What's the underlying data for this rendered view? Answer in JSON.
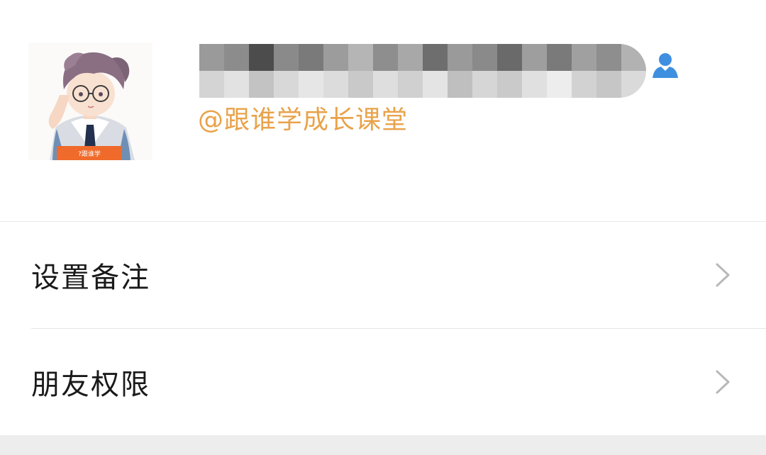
{
  "profile": {
    "display_name": "",
    "username": "@跟谁学成长课堂",
    "avatar": "avatar-illustration",
    "avatar_badge_text": "?跟谁学",
    "contact_icon": "person-icon",
    "accent_color": "#e9a24a",
    "icon_color": "#3f8fe0"
  },
  "menu": {
    "items": [
      {
        "label": "设置备注",
        "icon": "chevron-right-icon"
      },
      {
        "label": "朋友权限",
        "icon": "chevron-right-icon"
      }
    ]
  }
}
